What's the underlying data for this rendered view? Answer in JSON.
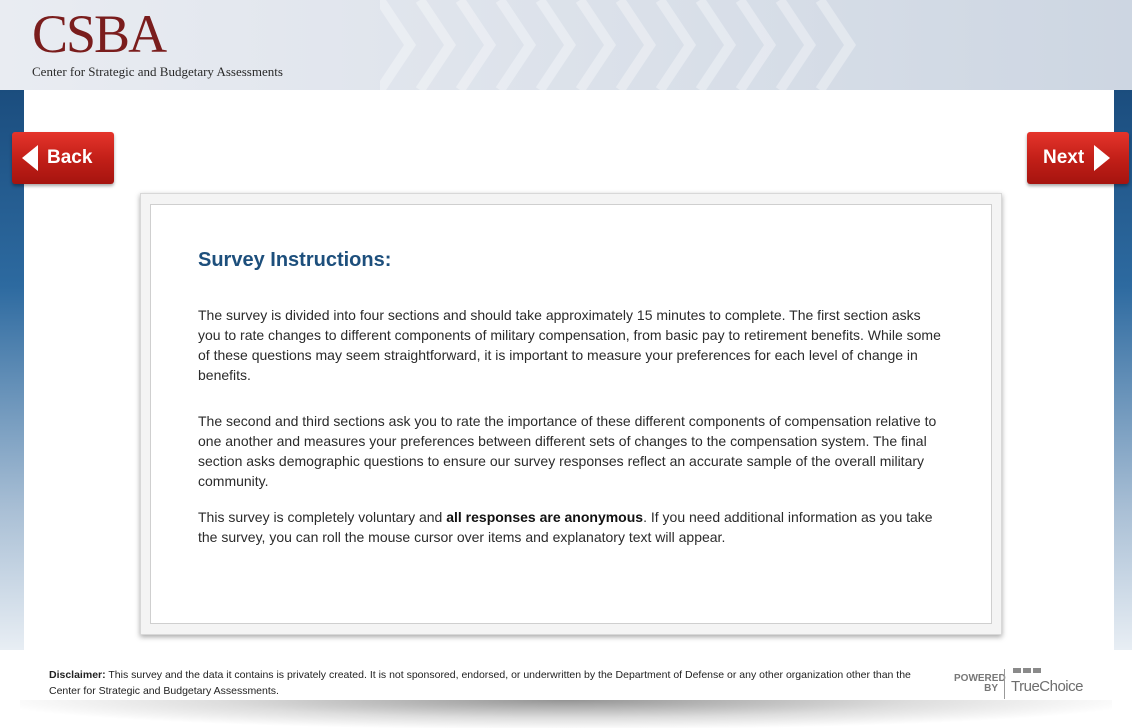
{
  "brand": {
    "logo_text": "CSBA",
    "subtitle": "Center for Strategic and Budgetary Assessments"
  },
  "nav": {
    "back_label": "Back",
    "next_label": "Next"
  },
  "instructions": {
    "title": "Survey Instructions:",
    "paragraph1": "The survey is divided into four sections and should take approximately 15 minutes to complete. The first section asks you to rate changes to different components of military compensation, from basic pay to retirement benefits. While some of these questions may seem straightforward, it is important to measure your preferences for each level of change in benefits.",
    "paragraph2": "The second and third sections ask you to rate the importance of these different components of compensation relative to one another and measures your preferences between different sets of changes to the compensation system. The final section asks demographic questions to ensure our survey responses reflect an accurate sample of the overall military community.",
    "paragraph3_before": "This survey is completely voluntary and ",
    "paragraph3_bold": "all responses are anonymous",
    "paragraph3_after": ". If you need additional information as you take the survey, you can roll the mouse cursor over items and explanatory text will appear."
  },
  "footer": {
    "disclaimer_label": "Disclaimer:",
    "disclaimer_text": " This survey and the data it contains is privately created. It is not sponsored, endorsed, or underwritten by the Department of Defense or any other organization other than the Center for Strategic and Budgetary Assessments.",
    "powered_line1": "POWERED",
    "powered_line2": "BY",
    "truechoice": "TrueChoice"
  },
  "colors": {
    "accent_red": "#c01e17",
    "title_blue": "#1d4f7c",
    "logo_maroon": "#7a1d1d",
    "side_blue": "#1b4d7e"
  }
}
